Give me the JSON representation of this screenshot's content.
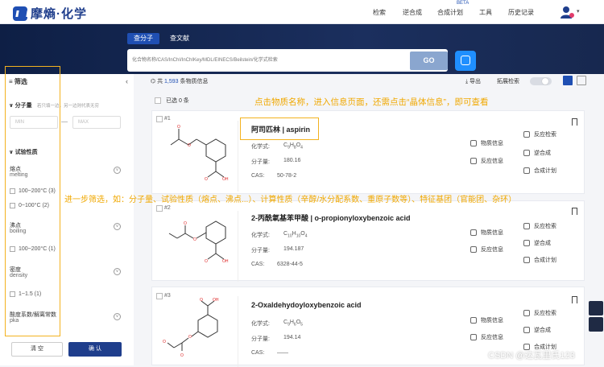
{
  "header": {
    "logo_text": "摩熵·化学",
    "nav": [
      "检索",
      "逆合成",
      "合成计划",
      "工具",
      "历史记录"
    ],
    "beta": "BETA"
  },
  "search": {
    "tabs": [
      "查分子",
      "查文献"
    ],
    "placeholder": "化合物名称/CAS/InChI/InChIKey/MDL/EINECS/Beilstein/化学式检索",
    "go_label": "GO"
  },
  "sidebar": {
    "title": "筛选",
    "mw_title": "分子量",
    "mw_hint": "若只填一边，另一边则代表无穷",
    "min_placeholder": "MIN",
    "max_placeholder": "MAX",
    "exp_title": "试验性质",
    "props": [
      {
        "zh": "熔点",
        "en": "melting",
        "options": [
          "100~200°C (3)",
          "0~100°C (2)"
        ]
      },
      {
        "zh": "沸点",
        "en": "boiling",
        "options": [
          "100~200°C (1)"
        ]
      },
      {
        "zh": "密度",
        "en": "density",
        "options": [
          "1~1.5 (1)"
        ]
      },
      {
        "zh": "酸度系数/解离常数",
        "en": "pka",
        "options": []
      }
    ],
    "clear_label": "清 空",
    "confirm_label": "确 认"
  },
  "toolbar": {
    "count_prefix": "共",
    "count": "1,593",
    "count_suffix": "条物质信息",
    "export": "导出",
    "expand": "拓展检索",
    "selected": "已选 0 条"
  },
  "results": [
    {
      "no": "#1",
      "name": "阿司匹林 | aspirin",
      "formula_label": "化学式:",
      "formula": "C9H8O4",
      "mw_label": "分子量:",
      "mw": "180.16",
      "cas_label": "CAS:",
      "cas": "50-78-2"
    },
    {
      "no": "#2",
      "name": "2-丙酰氧基苯甲酸 | o-propionyloxybenzoic acid",
      "formula_label": "化学式:",
      "formula": "C10H10O4",
      "mw_label": "分子量:",
      "mw": "194.187",
      "cas_label": "CAS:",
      "cas": "6328-44-5"
    },
    {
      "no": "#3",
      "name": "2-Oxaldehydoyloxybenzoic acid",
      "formula_label": "化学式:",
      "formula": "C9H6O5",
      "mw_label": "分子量:",
      "mw": "194.14",
      "cas_label": "CAS:",
      "cas": "——"
    }
  ],
  "card_links": {
    "substance": "物质信息",
    "reaction": "反应信息",
    "rxn_search": "反应检索",
    "retro": "逆合成",
    "plan": "合成计划"
  },
  "annotations": {
    "top": "点击物质名称，进入信息页面，还需点击“晶体信息”，即可查看",
    "middle": "进一步筛选，如：分子量、试验性质（熔点、沸点...）、计算性质（辛醇/水分配系数、重原子数等）、特征基团（官能团、杂环）"
  },
  "watermark": "CSDN @达瓦里氏123"
}
